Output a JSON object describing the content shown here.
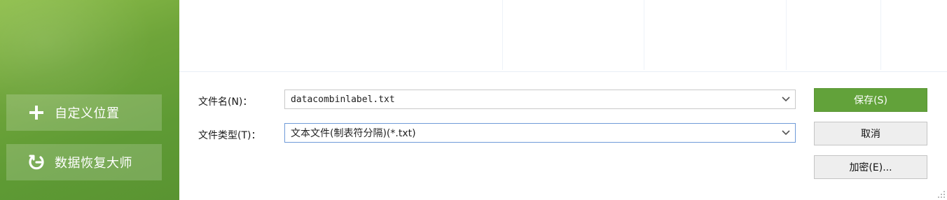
{
  "sidebar": {
    "custom_location": {
      "label": "自定义位置",
      "icon": "plus-icon"
    },
    "data_recovery": {
      "label": "数据恢复大师",
      "icon": "recovery-icon"
    }
  },
  "form": {
    "filename_label": "文件名(N)：",
    "filename_value": "datacombinlabel.txt",
    "filetype_label": "文件类型(T)：",
    "filetype_value": "文本文件(制表符分隔)(*.txt)"
  },
  "buttons": {
    "save": "保存(S)",
    "cancel": "取消",
    "encrypt": "加密(E)..."
  },
  "colors": {
    "accent": "#62a23a",
    "sidebar": "#6fa53a"
  }
}
